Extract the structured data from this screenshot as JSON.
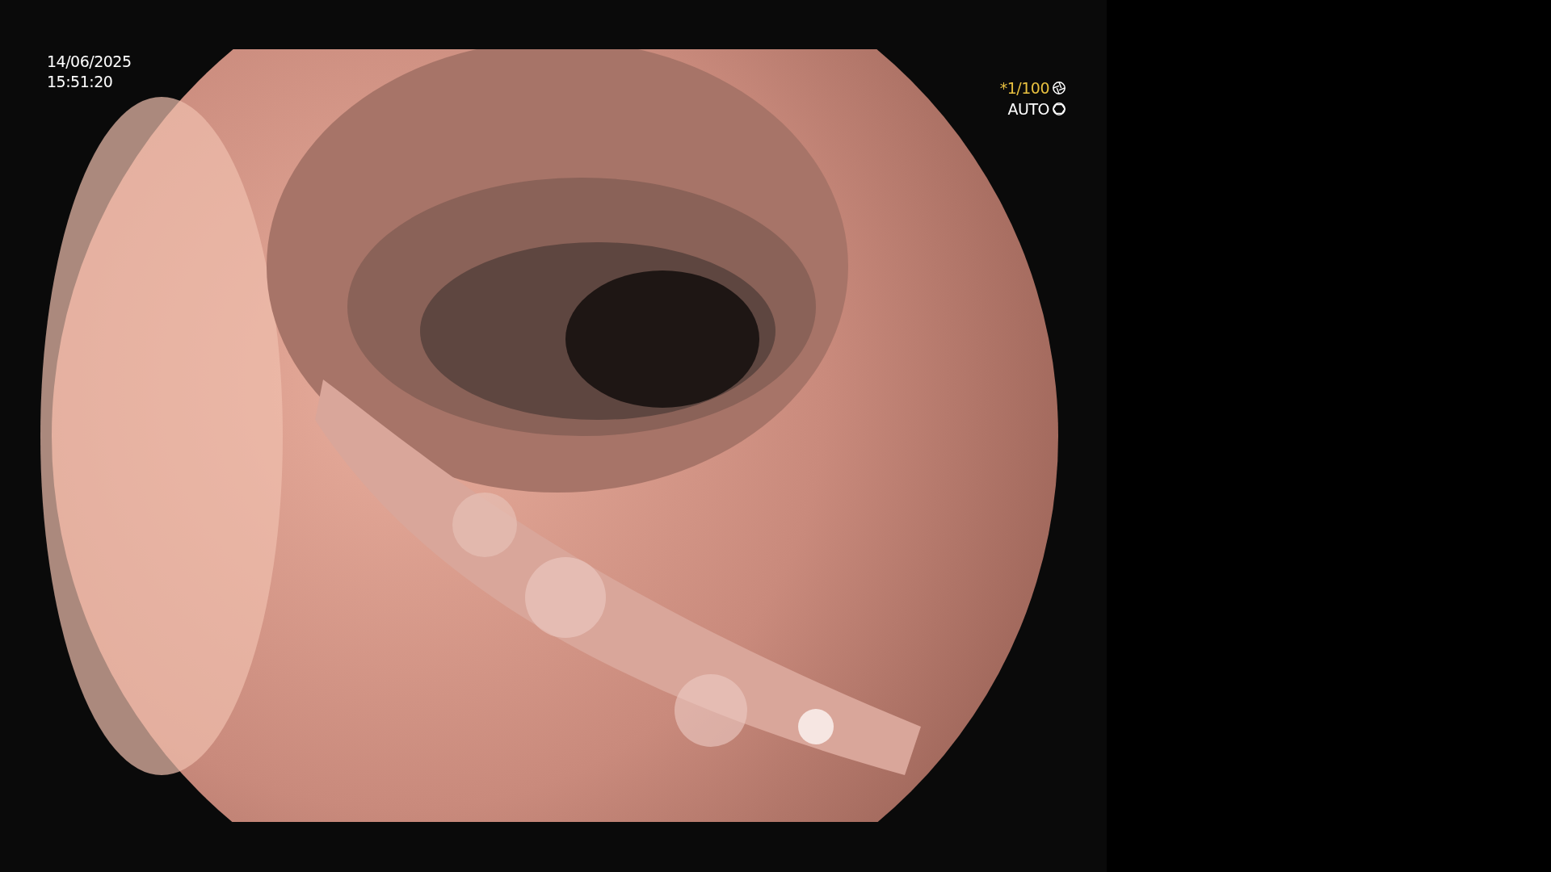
{
  "overlay": {
    "date": "14/06/2025",
    "time": "15:51:20",
    "shutter": "*1/100",
    "mode": "AUTO"
  }
}
